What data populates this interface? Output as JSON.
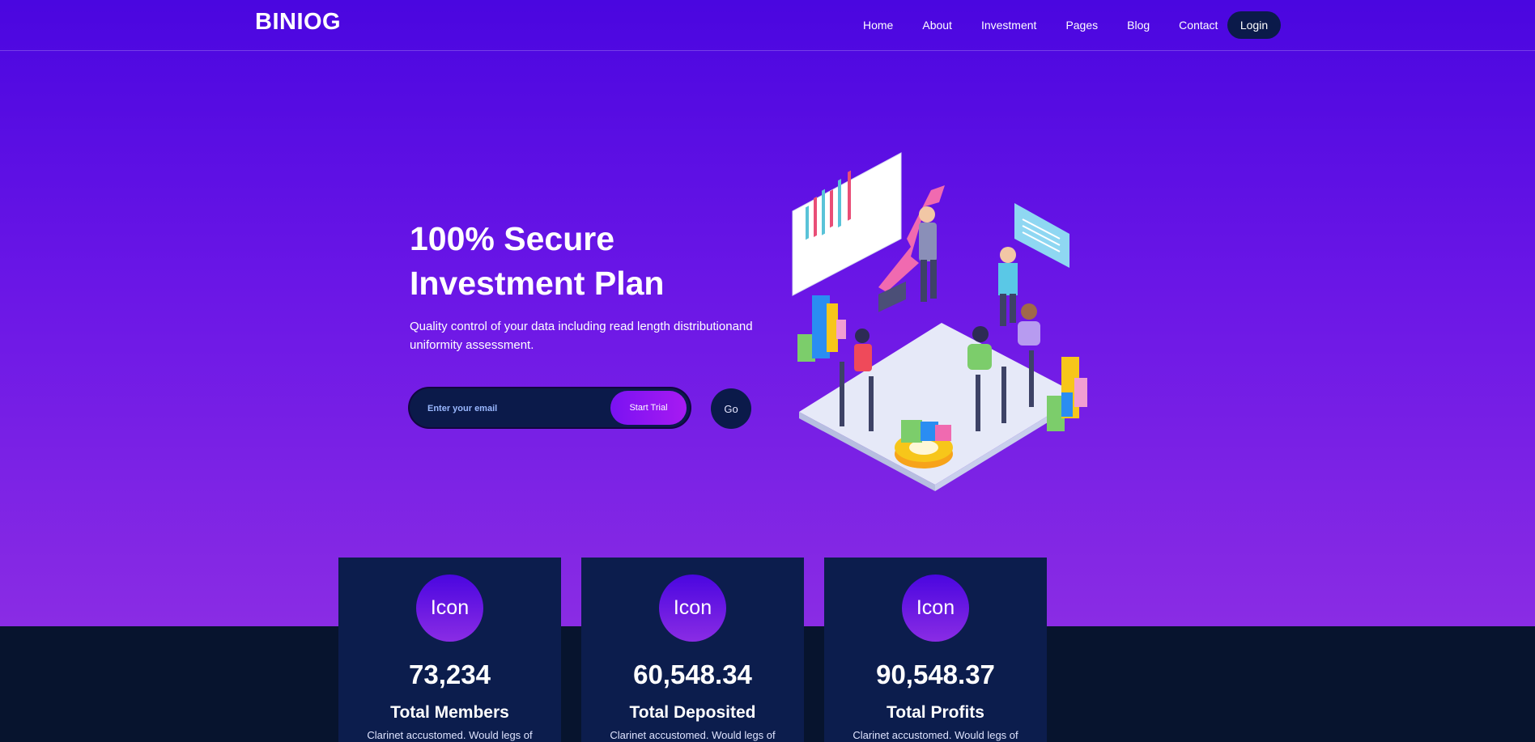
{
  "header": {
    "logo": "BINIOG",
    "nav": [
      "Home",
      "About",
      "Investment",
      "Pages",
      "Blog",
      "Contact"
    ],
    "login_label": "Login"
  },
  "hero": {
    "title_line1": "100% Secure",
    "title_line2": "Investment Plan",
    "subtitle": "Quality control of your data including read length distributionand uniformity assessment.",
    "email_placeholder": "Enter your email",
    "start_label": "Start Trial",
    "go_label": "Go"
  },
  "stats": [
    {
      "icon": "Icon",
      "value": "73,234",
      "label": "Total Members",
      "desc": "Clarinet accustomed. Would legs of"
    },
    {
      "icon": "Icon",
      "value": "60,548.34",
      "label": "Total Deposited",
      "desc": "Clarinet accustomed. Would legs of"
    },
    {
      "icon": "Icon",
      "value": "90,548.37",
      "label": "Total Profits",
      "desc": "Clarinet accustomed. Would legs of"
    }
  ],
  "colors": {
    "hero_top": "#4a06e0",
    "hero_bottom": "#8a2ce4",
    "navy": "#0b1a4a",
    "card_bg": "#0c1d4d",
    "footer_bg": "#07142e"
  }
}
